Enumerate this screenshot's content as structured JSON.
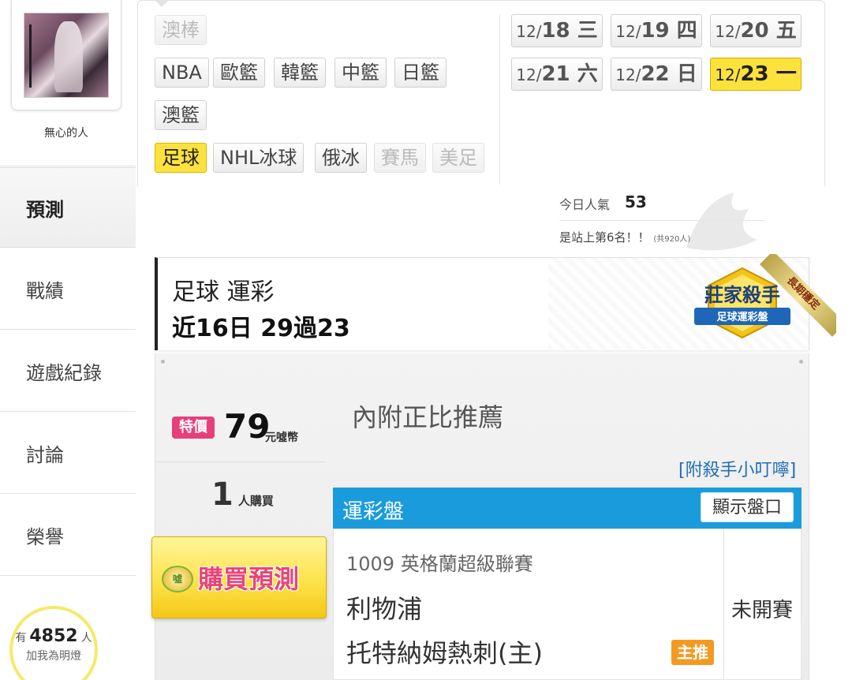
{
  "user": {
    "name": "無心的人"
  },
  "sidebar": {
    "items": [
      {
        "label": "預測",
        "active": true
      },
      {
        "label": "戰績"
      },
      {
        "label": "遊戲紀錄"
      },
      {
        "label": "討論"
      },
      {
        "label": "榮譽"
      }
    ],
    "fans": {
      "prefix": "有",
      "count": "4852",
      "suffix": "人",
      "line2": "加我為明燈"
    }
  },
  "sports": {
    "row0": [
      "澳棒"
    ],
    "row1": [
      "NBA",
      "歐籃",
      "韓籃",
      "中籃",
      "日籃"
    ],
    "row2": [
      "澳籃"
    ],
    "row3": [
      "足球",
      "NHL冰球",
      "俄冰",
      "賽馬",
      "美足"
    ],
    "active": "足球"
  },
  "dates": [
    {
      "month": "12/",
      "day": "18",
      "weekday": " 三"
    },
    {
      "month": "12/",
      "day": "19",
      "weekday": " 四"
    },
    {
      "month": "12/",
      "day": "20",
      "weekday": " 五"
    },
    {
      "month": "12/",
      "day": "21",
      "weekday": " 六"
    },
    {
      "month": "12/",
      "day": "22",
      "weekday": " 日"
    },
    {
      "month": "12/",
      "day": "23",
      "weekday": " 一",
      "active": true
    }
  ],
  "popularity": {
    "label": "今日人氣",
    "value": "53",
    "rank": "是站上第6名！！",
    "rank_sub": "(共920人)"
  },
  "card": {
    "title": "足球 運彩",
    "record": "近16日 29過23",
    "badge_main": "莊家殺手",
    "badge_sub": "足球運彩盤",
    "ribbon": "長期穩定"
  },
  "offer": {
    "tag": "特價",
    "price": "79",
    "unit": "元噓幣",
    "buyers": "1",
    "buyers_suffix": "人購買",
    "buy_label": "購買預測",
    "coin_label": "噓",
    "note": "內附正比推薦",
    "tips_link": "[附殺手小叮嚀]"
  },
  "odds": {
    "title": "運彩盤",
    "show_button": "顯示盤口",
    "match": {
      "league": "1009 英格蘭超級聯賽",
      "team1": "利物浦",
      "team2": "托特納姆熱刺(主)",
      "pick_badge": "主推",
      "status": "未開賽"
    }
  },
  "colors": {
    "accent_yellow": "#fde23d",
    "odds_blue": "#1a9cdc",
    "price_pink": "#e63f7c",
    "pick_orange": "#f39a23",
    "link_blue": "#1f6fb5"
  }
}
